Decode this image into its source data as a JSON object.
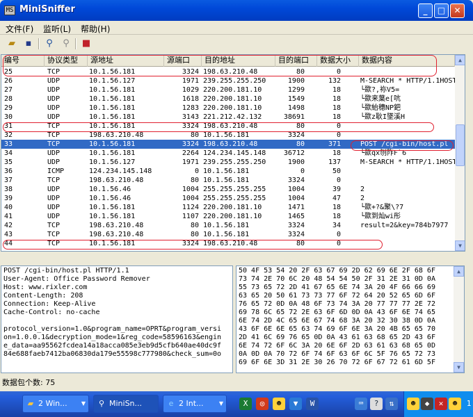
{
  "window": {
    "title": "MiniSniffer",
    "icon_label": "MS"
  },
  "menu": [
    "文件(F)",
    "监听(L)",
    "帮助(H)"
  ],
  "toolbar": [
    "open-folder-icon",
    "save-icon",
    "search-icon",
    "search-gray-icon",
    "stop-icon"
  ],
  "columns": [
    "编号",
    "协议类型",
    "源地址",
    "源端口",
    "目的地址",
    "目的端口",
    "数据大小",
    "数据内容"
  ],
  "packets": [
    {
      "no": "25",
      "proto": "TCP",
      "src": "10.1.56.181",
      "sport": "3324",
      "dst": "198.63.210.48",
      "dport": "80",
      "size": "0",
      "data": ""
    },
    {
      "no": "26",
      "proto": "UDP",
      "src": "10.1.56.127",
      "sport": "1971",
      "dst": "239.255.255.250",
      "dport": "1900",
      "size": "132",
      "data": "M-SEARCH * HTTP/1.1HOST"
    },
    {
      "no": "27",
      "proto": "UDP",
      "src": "10.1.56.181",
      "sport": "1029",
      "dst": "220.200.181.10",
      "dport": "1299",
      "size": "18",
      "data": "└欼?,袮V5="
    },
    {
      "no": "28",
      "proto": "UDP",
      "src": "10.1.56.181",
      "sport": "1618",
      "dst": "220.200.181.10",
      "dport": "1549",
      "size": "18",
      "data": "└欼来葉e[吭"
    },
    {
      "no": "29",
      "proto": "UDP",
      "src": "10.1.56.181",
      "sport": "1283",
      "dst": "220.200.181.10",
      "dport": "1498",
      "size": "18",
      "data": "└欼紿穗NP鈀"
    },
    {
      "no": "30",
      "proto": "UDP",
      "src": "10.1.56.181",
      "sport": "3143",
      "dst": "221.212.42.132",
      "dport": "38691",
      "size": "18",
      "data": "└欼z耿I墜溪H"
    },
    {
      "no": "31",
      "proto": "TCP",
      "src": "10.1.56.181",
      "sport": "3324",
      "dst": "198.63.210.48",
      "dport": "80",
      "size": "0",
      "data": ""
    },
    {
      "no": "32",
      "proto": "TCP",
      "src": "198.63.210.48",
      "sport": "80",
      "dst": "10.1.56.181",
      "dport": "3324",
      "size": "0",
      "data": ""
    },
    {
      "no": "33",
      "proto": "TCP",
      "src": "10.1.56.181",
      "sport": "3324",
      "dst": "198.63.210.48",
      "dport": "80",
      "size": "371",
      "data": "POST /cgi-bin/host.pl"
    },
    {
      "no": "34",
      "proto": "UDP",
      "src": "10.1.56.181",
      "sport": "2264",
      "dst": "124.234.145.148",
      "dport": "36712",
      "size": "18",
      "data": "└欼qx刎阼F`6"
    },
    {
      "no": "35",
      "proto": "UDP",
      "src": "10.1.56.127",
      "sport": "1971",
      "dst": "239.255.255.250",
      "dport": "1900",
      "size": "137",
      "data": "M-SEARCH * HTTP/1.1HOST"
    },
    {
      "no": "36",
      "proto": "ICMP",
      "src": "124.234.145.148",
      "sport": "0",
      "dst": "10.1.56.181",
      "dport": "0",
      "size": "50",
      "data": ""
    },
    {
      "no": "37",
      "proto": "TCP",
      "src": "198.63.210.48",
      "sport": "80",
      "dst": "10.1.56.181",
      "dport": "3324",
      "size": "0",
      "data": ""
    },
    {
      "no": "38",
      "proto": "UDP",
      "src": "10.1.56.46",
      "sport": "1004",
      "dst": "255.255.255.255",
      "dport": "1004",
      "size": "39",
      "data": "2"
    },
    {
      "no": "39",
      "proto": "UDP",
      "src": "10.1.56.46",
      "sport": "1004",
      "dst": "255.255.255.255",
      "dport": "1004",
      "size": "47",
      "data": "2"
    },
    {
      "no": "40",
      "proto": "UDP",
      "src": "10.1.56.181",
      "sport": "1124",
      "dst": "220.200.181.10",
      "dport": "1471",
      "size": "18",
      "data": "└欼+?&聚\\?7"
    },
    {
      "no": "41",
      "proto": "UDP",
      "src": "10.1.56.181",
      "sport": "1107",
      "dst": "220.200.181.10",
      "dport": "1465",
      "size": "18",
      "data": "└欼到灿wi彤"
    },
    {
      "no": "42",
      "proto": "TCP",
      "src": "198.63.210.48",
      "sport": "80",
      "dst": "10.1.56.181",
      "dport": "3324",
      "size": "34",
      "data": "result=2&key=784b7977"
    },
    {
      "no": "43",
      "proto": "TCP",
      "src": "198.63.210.48",
      "sport": "80",
      "dst": "10.1.56.181",
      "dport": "3324",
      "size": "0",
      "data": ""
    },
    {
      "no": "44",
      "proto": "TCP",
      "src": "10.1.56.181",
      "sport": "3324",
      "dst": "198.63.210.48",
      "dport": "80",
      "size": "0",
      "data": ""
    }
  ],
  "selected_packet": "33",
  "detail_text": "POST /cgi-bin/host.pl HTTP/1.1\nUser-Agent: Office Password Remover\nHost: www.rixler.com\nContent-Length: 208\nConnection: Keep-Alive\nCache-Control: no-cache\n\nprotocol_version=1.0&program_name=OPRT&program_versi\non=1.0.0.1&decryption_mode=1&reg_code=58596163&engin\ne_data=aa95562fcdea14a18acca085e3eb9d5cfb640ae40dc9f\n84e688faeb7412ba06830da179e55598c777980&check_sum=0o",
  "hex_text": "50 4F 53 54 20 2F 63 67 69 2D 62 69 6E 2F 68 6F\n73 74 2E 70 6C 20 48 54 54 50 2F 31 2E 31 0D 0A\n55 73 65 72 2D 41 67 65 6E 74 3A 20 4F 66 66 69\n63 65 20 50 61 73 73 77 6F 72 64 20 52 65 6D 6F\n76 65 72 0D 0A 48 6F 73 74 3A 20 77 77 77 2E 72\n69 78 6C 65 72 2E 63 6F 6D 0D 0A 43 6F 6E 74 65\n6E 74 2D 4C 65 6E 67 74 68 3A 20 32 30 38 0D 0A\n43 6F 6E 6E 65 63 74 69 6F 6E 3A 20 4B 65 65 70\n2D 41 6C 69 76 65 0D 0A 43 61 63 68 65 2D 43 6F\n6E 74 72 6F 6C 3A 20 6E 6F 2D 63 61 63 68 65 0D\n0A 0D 0A 70 72 6F 74 6F 63 6F 6C 5F 76 65 72 73\n69 6F 6E 3D 31 2E 30 26 70 72 6F 67 72 61 6D 5F",
  "status": "数据包个数: 75",
  "taskbar": {
    "tasks": [
      {
        "label": "2 Win...",
        "icon": "folder-icon",
        "active": false
      },
      {
        "label": "MiniSn...",
        "icon": "magnifier-icon",
        "active": true
      },
      {
        "label": "2 Int...",
        "icon": "ie-icon",
        "active": false
      }
    ]
  },
  "colors": {
    "selection": "#316AC5",
    "highlight_ring": "#e0202f",
    "titlebar": "#0048D8"
  }
}
